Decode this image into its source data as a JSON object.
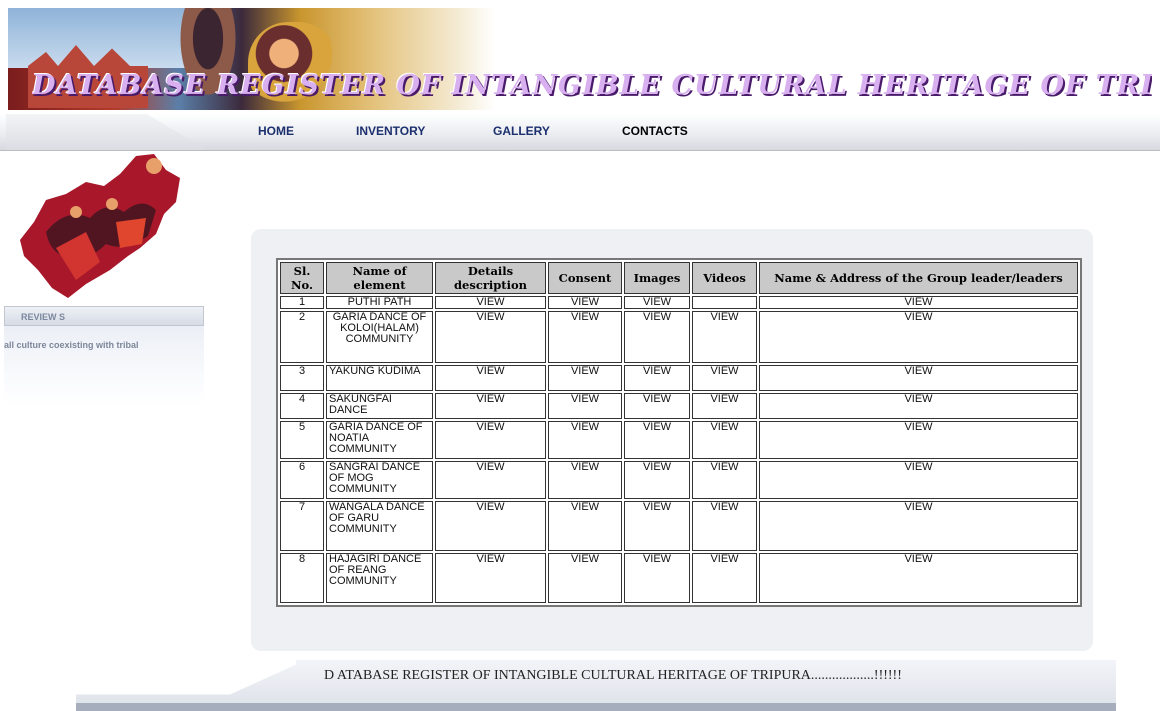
{
  "header": {
    "title": "DATABASE REGISTER OF INTANGIBLE CULTURAL HERITAGE OF TRIPURA"
  },
  "nav": {
    "items": [
      "HOME",
      "INVENTORY",
      "GALLERY",
      "CONTACTS"
    ]
  },
  "sidebar": {
    "reviews_label": "REVIEW S",
    "reviews_text": "all culture coexisting with tribal"
  },
  "table": {
    "headers": [
      "Sl. No.",
      "Name of element",
      "Details description",
      "Consent",
      "Images",
      "Videos",
      "Name & Address of the Group leader/leaders"
    ],
    "rows": [
      {
        "sl": "1",
        "name": "PUTHI PATH",
        "details": "VIEW",
        "consent": "VIEW",
        "images": "VIEW",
        "videos": "",
        "leader": "VIEW"
      },
      {
        "sl": "2",
        "name": "GARIA DANCE OF KOLOI(HALAM) COMMUNITY",
        "details": "VIEW",
        "consent": "VIEW",
        "images": "VIEW",
        "videos": "VIEW",
        "leader": "VIEW"
      },
      {
        "sl": "3",
        "name": "YAKUNG KUDIMA",
        "details": "VIEW",
        "consent": "VIEW",
        "images": "VIEW",
        "videos": "VIEW",
        "leader": "VIEW"
      },
      {
        "sl": "4",
        "name": "SAKUNGFAI DANCE",
        "details": "VIEW",
        "consent": "VIEW",
        "images": "VIEW",
        "videos": "VIEW",
        "leader": "VIEW"
      },
      {
        "sl": "5",
        "name": "GARIA DANCE OF NOATIA COMMUNITY",
        "details": "VIEW",
        "consent": "VIEW",
        "images": "VIEW",
        "videos": "VIEW",
        "leader": "VIEW"
      },
      {
        "sl": "6",
        "name": "SANGRAI DANCE OF MOG COMMUNITY",
        "details": "VIEW",
        "consent": "VIEW",
        "images": "VIEW",
        "videos": "VIEW",
        "leader": "VIEW"
      },
      {
        "sl": "7",
        "name": "WANGALA DANCE OF GARU COMMUNITY",
        "details": "VIEW",
        "consent": "VIEW",
        "images": "VIEW",
        "videos": "VIEW",
        "leader": "VIEW"
      },
      {
        "sl": "8",
        "name": "HAJAGIRI DANCE OF REANG COMMUNITY",
        "details": "VIEW",
        "consent": "VIEW",
        "images": "VIEW",
        "videos": "VIEW",
        "leader": "VIEW"
      }
    ]
  },
  "footer": {
    "text": "D ATABASE REGISTER OF INTANGIBLE CULTURAL HERITAGE OF TRIPURA..................!!!!!!"
  },
  "colors": {
    "link_orange": "#f37a54",
    "nav_blue": "#1c2f6e",
    "header_gray": "#c9c9c9"
  }
}
